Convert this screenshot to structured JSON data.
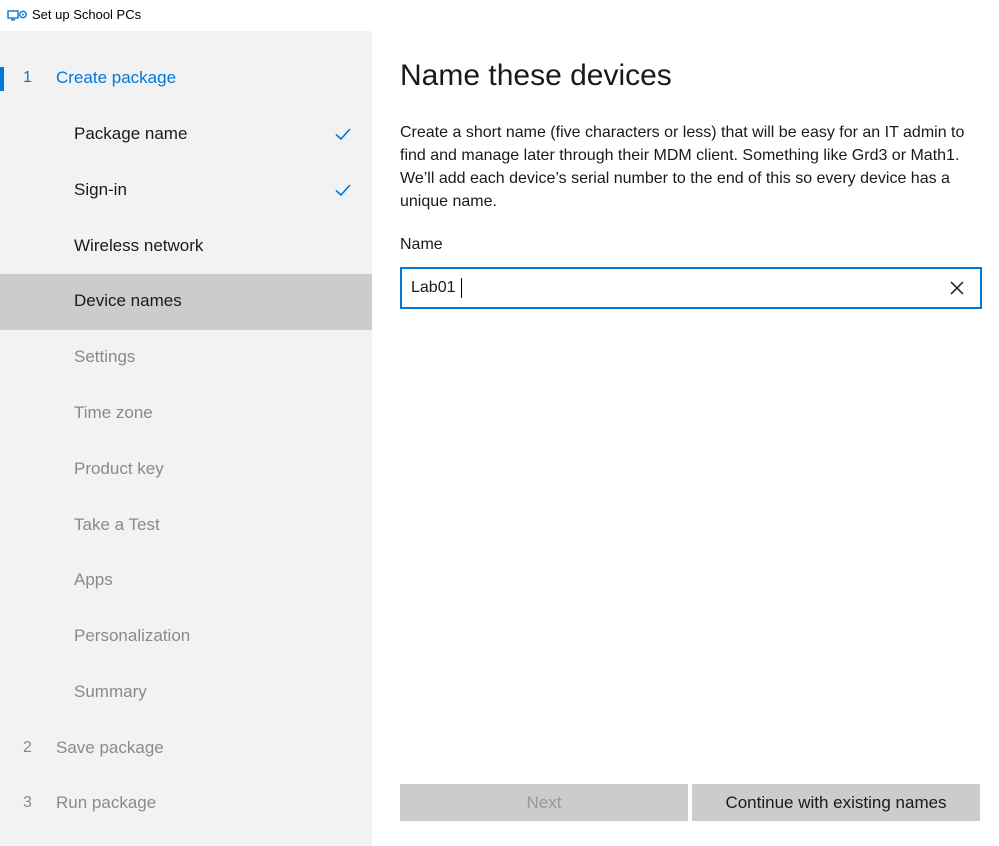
{
  "window": {
    "title": "Set up School PCs",
    "icon": "school-pcs-app-icon"
  },
  "sidebar": {
    "steps": [
      {
        "number": "1",
        "label": "Create package",
        "state": "active"
      },
      {
        "number": "2",
        "label": "Save package",
        "state": "disabled"
      },
      {
        "number": "3",
        "label": "Run package",
        "state": "disabled"
      }
    ],
    "substeps": [
      {
        "label": "Package name",
        "state": "complete",
        "icon": "checkmark-icon"
      },
      {
        "label": "Sign-in",
        "state": "complete",
        "icon": "checkmark-icon"
      },
      {
        "label": "Wireless network",
        "state": "enabled"
      },
      {
        "label": "Device names",
        "state": "selected"
      },
      {
        "label": "Settings",
        "state": "disabled"
      },
      {
        "label": "Time zone",
        "state": "disabled"
      },
      {
        "label": "Product key",
        "state": "disabled"
      },
      {
        "label": "Take a Test",
        "state": "disabled"
      },
      {
        "label": "Apps",
        "state": "disabled"
      },
      {
        "label": "Personalization",
        "state": "disabled"
      },
      {
        "label": "Summary",
        "state": "disabled"
      }
    ]
  },
  "main": {
    "heading": "Name these devices",
    "description": "Create a short name (five characters or less) that will be easy for an IT admin to find and manage later through their MDM client. Something like Grd3 or Math1. We’ll add each device’s serial number to the end of this so every device has a unique name.",
    "name_label": "Name",
    "name_value": "Lab01",
    "clear_icon": "close-icon"
  },
  "footer": {
    "next_label": "Next",
    "next_enabled": false,
    "continue_label": "Continue with existing names"
  },
  "colors": {
    "accent": "#0078d7",
    "sidebar_bg": "#f2f2f2",
    "selected_bg": "#cccccc",
    "disabled_text": "#8a8a8a"
  }
}
